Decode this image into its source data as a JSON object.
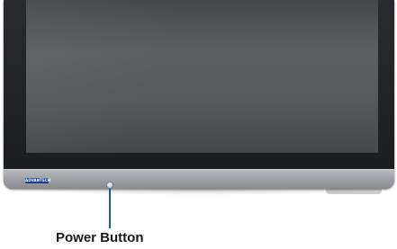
{
  "diagram": {
    "brand_logo": "ADVANTECH",
    "callout_label": "Power Button"
  }
}
